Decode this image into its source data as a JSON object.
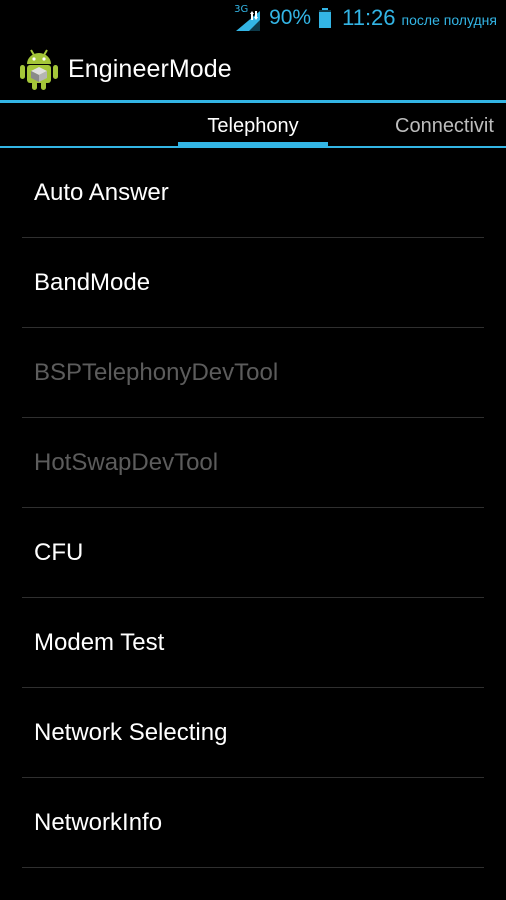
{
  "status_bar": {
    "network_type": "3G",
    "battery_percent": "90%",
    "time": "11:26",
    "ampm": "после полудня",
    "accent_color": "#33b5e5",
    "icons": [
      "signal-icon",
      "battery-icon"
    ]
  },
  "action_bar": {
    "title": "EngineerMode",
    "icon": "android-robot-icon"
  },
  "tabs": [
    {
      "label": "Telephony",
      "selected": true
    },
    {
      "label": "Connectivit",
      "selected": false
    }
  ],
  "list": {
    "items": [
      {
        "label": "Auto Answer",
        "enabled": true
      },
      {
        "label": "BandMode",
        "enabled": true
      },
      {
        "label": "BSPTelephonyDevTool",
        "enabled": false
      },
      {
        "label": "HotSwapDevTool",
        "enabled": false
      },
      {
        "label": "CFU",
        "enabled": true
      },
      {
        "label": "Modem Test",
        "enabled": true
      },
      {
        "label": "Network Selecting",
        "enabled": true
      },
      {
        "label": "NetworkInfo",
        "enabled": true
      }
    ]
  },
  "colors": {
    "accent": "#33b5e5",
    "background": "#000000",
    "disabled_text": "#5c5c5c"
  }
}
